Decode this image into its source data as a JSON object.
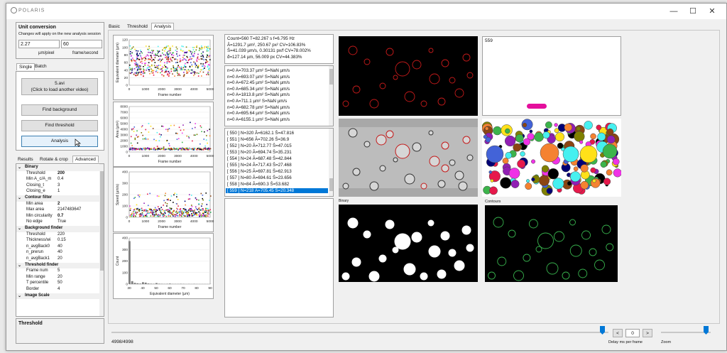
{
  "titlebar": {
    "app_logo": "POLARIS",
    "minimize": "—",
    "maximize": "☐",
    "close": "✕"
  },
  "unit_conversion": {
    "title": "Unit conversion",
    "note": "Changes will apply on the new analysis session",
    "um_per_pixel_value": "2.27",
    "frame_per_second_value": "60",
    "um_per_pixel_label": "µm/pixel",
    "frame_per_second_label": "frame/second"
  },
  "mode_tabs": [
    "Single",
    "Batch"
  ],
  "actions": {
    "load_video_line1": "5.avi",
    "load_video_line2": "(Click to load another video)",
    "find_background": "Find background",
    "find_threshold": "Find threshold",
    "analysis": "Analysis"
  },
  "settings_tabs": [
    "Results",
    "Rotate & crop",
    "Advanced"
  ],
  "properties": [
    {
      "cat": true,
      "k": "Binary"
    },
    {
      "k": "Threshold",
      "v": "200",
      "bold": true
    },
    {
      "k": "Min A_c/A_m",
      "v": "0.4"
    },
    {
      "k": "Closing_t",
      "v": "3"
    },
    {
      "k": "Closing_e",
      "v": "1"
    },
    {
      "cat": true,
      "k": "Contour filter"
    },
    {
      "k": "Min area",
      "v": "2",
      "bold": true
    },
    {
      "k": "Max area",
      "v": "2147483647"
    },
    {
      "k": "Min circularity",
      "v": "0.7",
      "bold": true
    },
    {
      "k": "No edge",
      "v": "True"
    },
    {
      "cat": true,
      "k": "Background finder"
    },
    {
      "k": "Threshold",
      "v": "220"
    },
    {
      "k": "Thickness/wi",
      "v": "0.15"
    },
    {
      "k": "n_avgBack0",
      "v": "40"
    },
    {
      "k": "n_prerun",
      "v": "40"
    },
    {
      "k": "n_avgBack1",
      "v": "20"
    },
    {
      "cat": true,
      "k": "Threshold finder"
    },
    {
      "k": "Frame num",
      "v": "5"
    },
    {
      "k": "Min range",
      "v": "20"
    },
    {
      "k": "T percentile",
      "v": "50"
    },
    {
      "k": "Border",
      "v": "4"
    },
    {
      "cat": true,
      "k": "Image Scale"
    }
  ],
  "description_title": "Threshold",
  "main_tabs": [
    "Basic",
    "Threshold",
    "Analysis"
  ],
  "summary_lines": [
    "Count=560  T=82.267 s  f=6.795 Hz",
    "Ā=1291.7 µm², 250.67 px²  CV=106.83%",
    "S̄=41.039 µm/s, 0.30131 px/f  CV=78.002%",
    "d̄=127.14 µm, 56.009 px  CV=44.383%"
  ],
  "stats_list": [
    "n=0  A=703.37 µm²  S=NaN µm/s",
    "n=0  A=693.07 µm²  S=NaN µm/s",
    "n=0  A=672.45 µm²  S=NaN µm/s",
    "n=0  A=685.34 µm²  S=NaN µm/s",
    "n=0  A=1813.8 µm²  S=NaN µm/s",
    "n=0  A=711.1 µm²  S=NaN µm/s",
    "n=0  A=682.78 µm²  S=NaN µm/s",
    "n=0  A=695.64 µm²  S=NaN µm/s",
    "n=0  A=6155.1 µm²  S=NaN µm/s"
  ],
  "track_list": [
    "[ 550 ]  N=320  Ā=6162.1  S̄=47.816",
    "[ 551 ]  N=656  Ā=702.26  S̄=36.9",
    "[ 552 ]  N=20  Ā=712.77  S̄=47.015",
    "[ 553 ]  N=20  Ā=694.74  S̄=35.231",
    "[ 554 ]  N=24  Ā=687.48  S̄=42.844",
    "[ 555 ]  N=24  Ā=717.43  S̄=27.468",
    "[ 556 ]  N=25  Ā=697.81  S̄=62.913",
    "[ 557 ]  N=80  Ā=694.61  S̄=23.656",
    "[ 558 ]  N=84  Ā=690.3  S̄=53.682",
    "[ 559 ]  N=218  Ā=705.45  S̄=20.348"
  ],
  "image_labels": {
    "track_id": "559",
    "binary": "Binary",
    "contours": "Contours"
  },
  "bottom": {
    "frame_counter": "4998/4998",
    "step_value": "0",
    "prev": "<",
    "next": ">",
    "delay_label": "Delay ms per frame",
    "zoom_label": "Zoom"
  },
  "charts": {
    "diameter": {
      "type": "scatter",
      "ylabel": "Equivalent diameter (µm)",
      "xlabel": "Frame number",
      "yticks": [
        "0",
        "20",
        "40",
        "60",
        "80",
        "100",
        "120"
      ],
      "xticks": [
        "0",
        "1000",
        "2000",
        "3000",
        "4000",
        "5000"
      ]
    },
    "area": {
      "type": "scatter",
      "ylabel": "Area (µm²)",
      "xlabel": "Frame number",
      "yticks": [
        "0",
        "1000",
        "2000",
        "3000",
        "4000",
        "5000",
        "6000",
        "7000",
        "8000"
      ],
      "xticks": [
        "0",
        "1000",
        "2000",
        "3000",
        "4000",
        "5000"
      ]
    },
    "speed": {
      "type": "scatter",
      "ylabel": "Speed (µm/s)",
      "xlabel": "Frame number",
      "yticks": [
        "0",
        "100",
        "200",
        "300",
        "400"
      ],
      "xticks": [
        "0",
        "1000",
        "2000",
        "3000",
        "4000",
        "5000"
      ]
    },
    "histogram": {
      "type": "bar",
      "ylabel": "Count",
      "xlabel": "Equivalent diameter (µm)",
      "yticks": [
        "0",
        "100",
        "200",
        "300",
        "400"
      ],
      "xticks": [
        "30",
        "40",
        "50",
        "60",
        "70",
        "80",
        "90"
      ],
      "ylim": [
        0,
        450
      ],
      "categories": [
        30,
        32,
        34,
        36,
        38,
        40,
        42,
        44,
        46,
        48,
        50,
        52,
        54,
        56,
        58,
        60,
        62,
        64,
        66,
        68,
        70,
        72,
        74,
        76,
        78,
        80,
        82,
        84,
        86,
        88,
        90
      ],
      "values": [
        405,
        28,
        12,
        8,
        5,
        18,
        14,
        6,
        4,
        3,
        10,
        4,
        3,
        2,
        3,
        5,
        2,
        2,
        2,
        3,
        2,
        1,
        2,
        1,
        2,
        1,
        1,
        1,
        1,
        1,
        1
      ]
    }
  },
  "colors": {
    "accent": "#0078d7",
    "selection": "#0078d7"
  }
}
